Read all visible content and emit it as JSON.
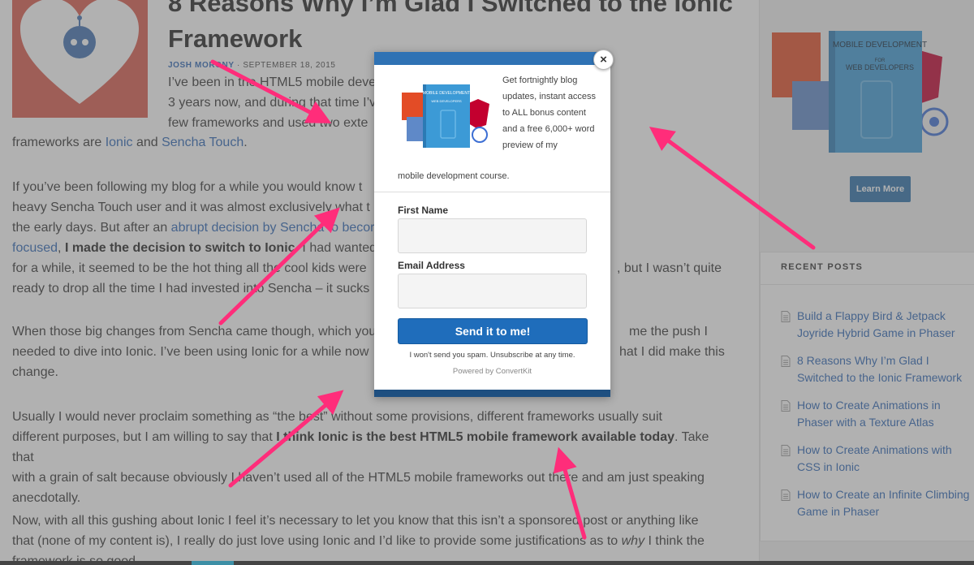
{
  "article": {
    "title": "8 Reasons Why I’m Glad I Switched to the Ionic Framework",
    "author": "JOSH MORONY",
    "date": "SEPTEMBER 18, 2015",
    "p1": {
      "t1": "I’ve been in the HTML5 mobile deve",
      "t2": "3 years now, and during that time I’v",
      "t3": "few frameworks and used two exte",
      "t4": "frameworks are ",
      "ionic": "Ionic",
      "and": " and ",
      "sencha": "Sencha Touch",
      "end": "."
    },
    "p2": {
      "t1": "If you’ve been following my blog for a while you would know t",
      "t2": "heavy Sencha Touch user and it was almost exclusively what t",
      "t3": "the early days. But after an ",
      "link": "abrupt decision by Sencha to becor",
      "link2": "focused",
      "t4": ", ",
      "bold": "I made the decision to switch to Ionic",
      "t5": ". I had wanted t",
      "t6": "for a while, it seemed to be the hot thing all the cool kids were",
      "t6b": ", but I wasn’t quite",
      "t7": "ready to drop all the time I had invested into Sencha – it sucks"
    },
    "p3": {
      "t1": "When those big changes from Sencha came though, which you",
      "t1b": "me the push I",
      "t2": "needed to dive into Ionic. I’ve been using Ionic for a while now",
      "t2b": "hat I did make this",
      "t3": "change."
    },
    "p4": {
      "t1": "Usually I would never proclaim something as “the best” without some provisions, different frameworks usually suit",
      "t2a": "different purposes, but I am willing to say that ",
      "bold": "I think Ionic is the best HTML5 mobile framework available today",
      "t2b": ". Take that",
      "t3": "with a grain of salt because obviously I haven’t used all of the HTML5 mobile frameworks out there and am just speaking",
      "t4": "anecdotally."
    },
    "p5": {
      "t1": "Now, with all this gushing about Ionic I feel it’s necessary to let you know that this isn’t a sponsored post or anything like",
      "t2a": "that (none of my content is), I really do just love using Ionic and I’d like to provide some justifications as to ",
      "em": "why",
      "t2b": " I think the",
      "t3": "framework is so good."
    }
  },
  "sidebar": {
    "book_title": "MOBILE DEVELOPMENT",
    "book_for": "FOR",
    "book_sub": "WEB DEVELOPERS",
    "learn_more": "Learn More",
    "recent_title": "RECENT POSTS",
    "posts": [
      {
        "title": "Build a Flappy Bird & Jetpack Joyride Hybrid Game in Phaser"
      },
      {
        "title": "8 Reasons Why I’m Glad I Switched to the Ionic Framework"
      },
      {
        "title": "How to Create Animations in Phaser with a Texture Atlas"
      },
      {
        "title": "How to Create Animations with CSS in Ionic"
      },
      {
        "title": "How to Create an Infinite Climbing Game in Phaser"
      }
    ]
  },
  "modal": {
    "promo_text": "Get fortnightly blog updates, instant access to ALL bonus content and a free 6,000+ word preview of my",
    "promo_text2": "mobile development course.",
    "book_title": "MOBILE DEVELOPMENT",
    "book_sub": "WEB DEVELOPERS",
    "first_name_label": "First Name",
    "first_name_value": "",
    "email_label": "Email Address",
    "email_value": "",
    "submit_label": "Send it to me!",
    "spam_note": "I won't send you spam. Unsubscribe at any time.",
    "powered_by": "Powered by ConvertKit",
    "close_symbol": "×"
  },
  "colors": {
    "link": "#2b65b5",
    "modal_bar": "#2f72b4",
    "button": "#1f6dbb",
    "arrow": "#ff2d7a",
    "overlay": "rgba(100,100,100,0.5)"
  }
}
